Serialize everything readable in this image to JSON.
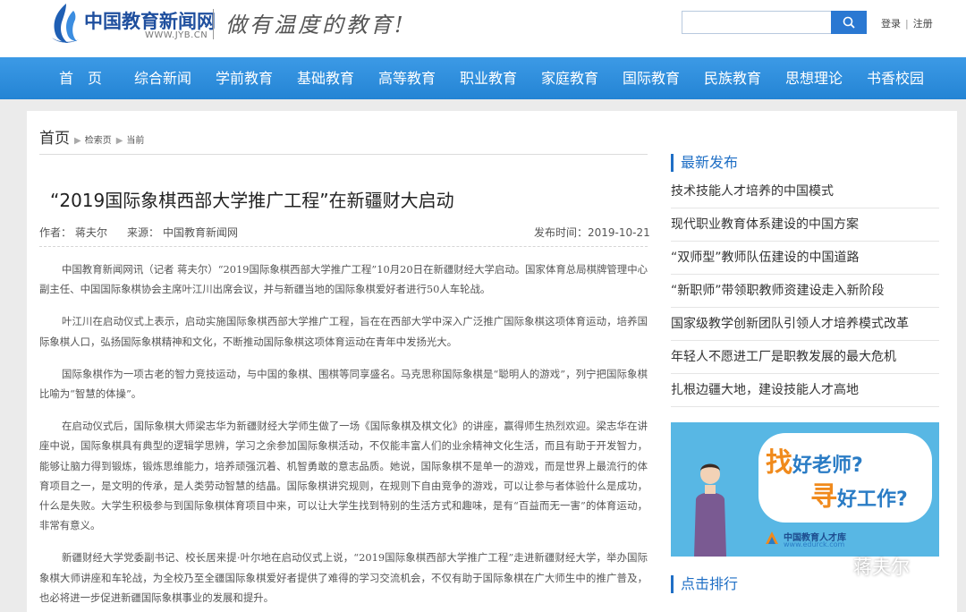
{
  "header": {
    "logo_text": "中国教育新闻网",
    "logo_url": "WWW.JYB.CN",
    "slogan": "做有温度的教育!",
    "search_placeholder": "",
    "login_label": "登录",
    "register_label": "注册",
    "link_separator": "|"
  },
  "nav": {
    "items": [
      "首　页",
      "综合新闻",
      "学前教育",
      "基础教育",
      "高等教育",
      "职业教育",
      "家庭教育",
      "国际教育",
      "民族教育",
      "思想理论",
      "书香校园"
    ]
  },
  "breadcrumb": {
    "home": "首页",
    "search": "检索页",
    "current": "当前"
  },
  "article": {
    "title": "“2019国际象棋西部大学推广工程”在新疆财大启动",
    "author_label": "作者：",
    "author": "蒋夫尔",
    "source_label": "来源：",
    "source": "中国教育新闻网",
    "pubtime_label": "发布时间：",
    "pubtime": "2019-10-21",
    "paragraphs": [
      "中国教育新闻网讯（记者 蒋夫尔）“2019国际象棋西部大学推广工程”10月20日在新疆财经大学启动。国家体育总局棋牌管理中心副主任、中国国际象棋协会主席叶江川出席会议，并与新疆当地的国际象棋爱好者进行50人车轮战。",
      "叶江川在启动仪式上表示，启动实施国际象棋西部大学推广工程，旨在在西部大学中深入广泛推广国际象棋这项体育运动，培养国际象棋人口，弘扬国际象棋精神和文化，不断推动国际象棋这项体育运动在青年中发扬光大。",
      "国际象棋作为一项古老的智力竞技运动，与中国的象棋、围棋等同享盛名。马克思称国际象棋是“聪明人的游戏”，列宁把国际象棋比喻为“智慧的体操”。",
      "在启动仪式后，国际象棋大师梁志华为新疆财经大学师生做了一场《国际象棋及棋文化》的讲座，赢得师生热烈欢迎。梁志华在讲座中说，国际象棋具有典型的逻辑学思辨，学习之余参加国际象棋活动，不仅能丰富人们的业余精神文化生活，而且有助于开发智力，能够让脑力得到锻炼，锻炼思维能力，培养顽强沉着、机智勇敢的意志品质。她说，国际象棋不是单一的游戏，而是世界上最流行的体育项目之一，是文明的传承，是人类劳动智慧的结晶。国际象棋讲究规则，在规则下自由竞争的游戏，可以让参与者体验什么是成功，什么是失败。大学生积极参与到国际象棋体育项目中来，可以让大学生找到特别的生活方式和趣味，是有“百益而无一害”的体育运动，非常有意义。",
      "新疆财经大学党委副书记、校长居来提·叶尔地在启动仪式上说，“2019国际象棋西部大学推广工程”走进新疆财经大学，举办国际象棋大师讲座和车轮战，为全校乃至全疆国际象棋爱好者提供了难得的学习交流机会，不仅有助于国际象棋在广大师生中的推广普及，也必将进一步促进新疆国际象棋事业的发展和提升。"
    ]
  },
  "sidebar": {
    "latest_title": "最新发布",
    "latest_items": [
      "技术技能人才培养的中国模式",
      "现代职业教育体系建设的中国方案",
      "“双师型”教师队伍建设的中国道路",
      "“新职师”带领职教师资建设走入新阶段",
      "国家级教学创新团队引领人才培养模式改革",
      "年轻人不愿进工厂是职教发展的最大危机",
      "扎根边疆大地，建设技能人才高地"
    ],
    "ad": {
      "line1_big": "找",
      "line1_small": "好老师?",
      "line2_big": "寻",
      "line2_small": "好工作?",
      "brand_name": "中国教育人才库",
      "brand_url": "www.edurck.com"
    },
    "ranking_title": "点击排行"
  },
  "watermark": "蒋夫尔",
  "colors": {
    "nav_blue": "#2a8ad8",
    "accent_blue": "#1f6fc5",
    "ad_bg": "#58b7e4",
    "ad_orange": "#f08a1c"
  }
}
